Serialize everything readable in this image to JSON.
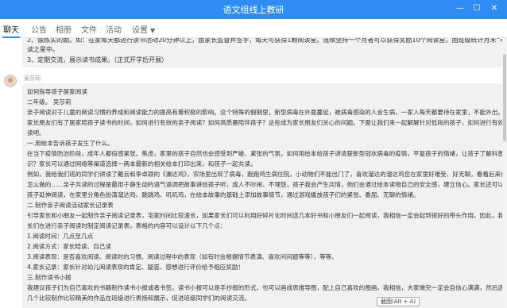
{
  "window": {
    "title": "语文组线上教研",
    "minimize": "—",
    "maximize": "☐",
    "close": "✕"
  },
  "tabs": [
    {
      "label": "聊天",
      "active": true
    },
    {
      "label": "公告"
    },
    {
      "label": "相册"
    },
    {
      "label": "文件"
    },
    {
      "label": "活动"
    },
    {
      "label": "设置"
    }
  ],
  "prev_message": {
    "lines": [
      "2、锻炼实的朗。如：在家每天都进行读书活动20分钟以上，由家长监督并签字，每天可获得1颗阅读星。连续坚持一个月者可以获得奖励10个阅读星。由班级统计月末“寻星大比拼”的阅",
      "读之星中。",
      "3、定期交流，展示读书成果。（正式开学后开展）"
    ]
  },
  "message": {
    "sender": "吴莎莉",
    "lines": [
      "如何指导孩子居家阅读",
      "二年级。 吴莎莉",
      "     亲子阅读对于儿童的阅读习惯的养成和阅读能力的提高有着积极的影响。这个特殊的假期里，新型病毒在外面蔓延，被病毒感染的人会生病，一家人每天都要待在家里，不能外出。很多",
      "家长朋友们有了居家陪孩子读书的时间，如何进行有效的亲子阅读？如何高质量陪伴孩子？这些成为家长朋友们关心的问题。下面让我们来一起解解针对低段的孩子，如何进行有效的亲子阅",
      "读吧。",
      "一.用绘本告诉孩子发生了什么。",
      "     在当下疫情防治阶段，成年人都倍感紧张、焦虑，家里的孩子自然也会感受到严峻、紧张的气氛，如何用绘本给孩子讲清楚新型冠状病毒的疫情，平复孩子的情绪，让孩子了解科普知",
      "识？家长可以通过网络等渠道选择一两本最新的相关绘本打印出来，和孩子一起共读。",
      "     例如，我给我们班的同学们讲读了戴云和李卓颖的《漏达鸡》，农场里出现了病毒，跑跑鸡生病住院，小动物们不能出门了，喜欢溜达的溜达鸡您在家里好难受、好无聊。看看后来他是",
      "怎么做的……亲子共读的过程是最用于静生动的语气语调把故事讲给孩子听，成人不吵闹、不埋怨，孩子我会产生共情，他们会通过绘本读物自己的安全感，建立信心。家长还可以陪着",
      "孩子延伸阅读，在家里分角色扮演溜达鸡、跳跳鸡、叽叽鸡，在绘本故事的基础上添加故事情节，通过游戏缓放孩子们的紧张、委屈、无聊的情绪。",
      "二.制作亲子阅读活动家长记录表",
      "     引导家长和小朋友一起制作亲子阅读记录表，宅家时间比较漫长，如果家长们可以利用好碎片化时间选几本好书和小朋友们一起阅读，我相信一定会起到很好的带头作用。因此，我指导家",
      "长们在进行亲子阅读时制定阅读记录表，表格的内容可以设计以下几个点：",
      " 1.阅读时间：几点至几点",
      "2.阅读方式：家长陪读、自己读",
      "3.阅读表现：是否喜欢阅读、阅读时的习惯、阅读过程中的表现（如有时会根据情节表演、喜欢问问题等等），等等。",
      "4.家长记录：家长针对幼儿阅读表现的肯定、疑惑、感想进行评价给予相应奖励！",
      "三.制作读书小报",
      "          我建议孩子们为自己喜欢的书籍制作读书小报或者书签。读书小报可以是手抄报的形式，也可以画成思维导图，配上自己喜欢的图画，我相信，大家做完一定会自信心满满，然后选取",
      "几个比较制作比较精美的作品在班级进行表扬和展示，促进班级同学们的阅读交流。"
    ]
  },
  "tooltip": "截图(Alt + A)"
}
